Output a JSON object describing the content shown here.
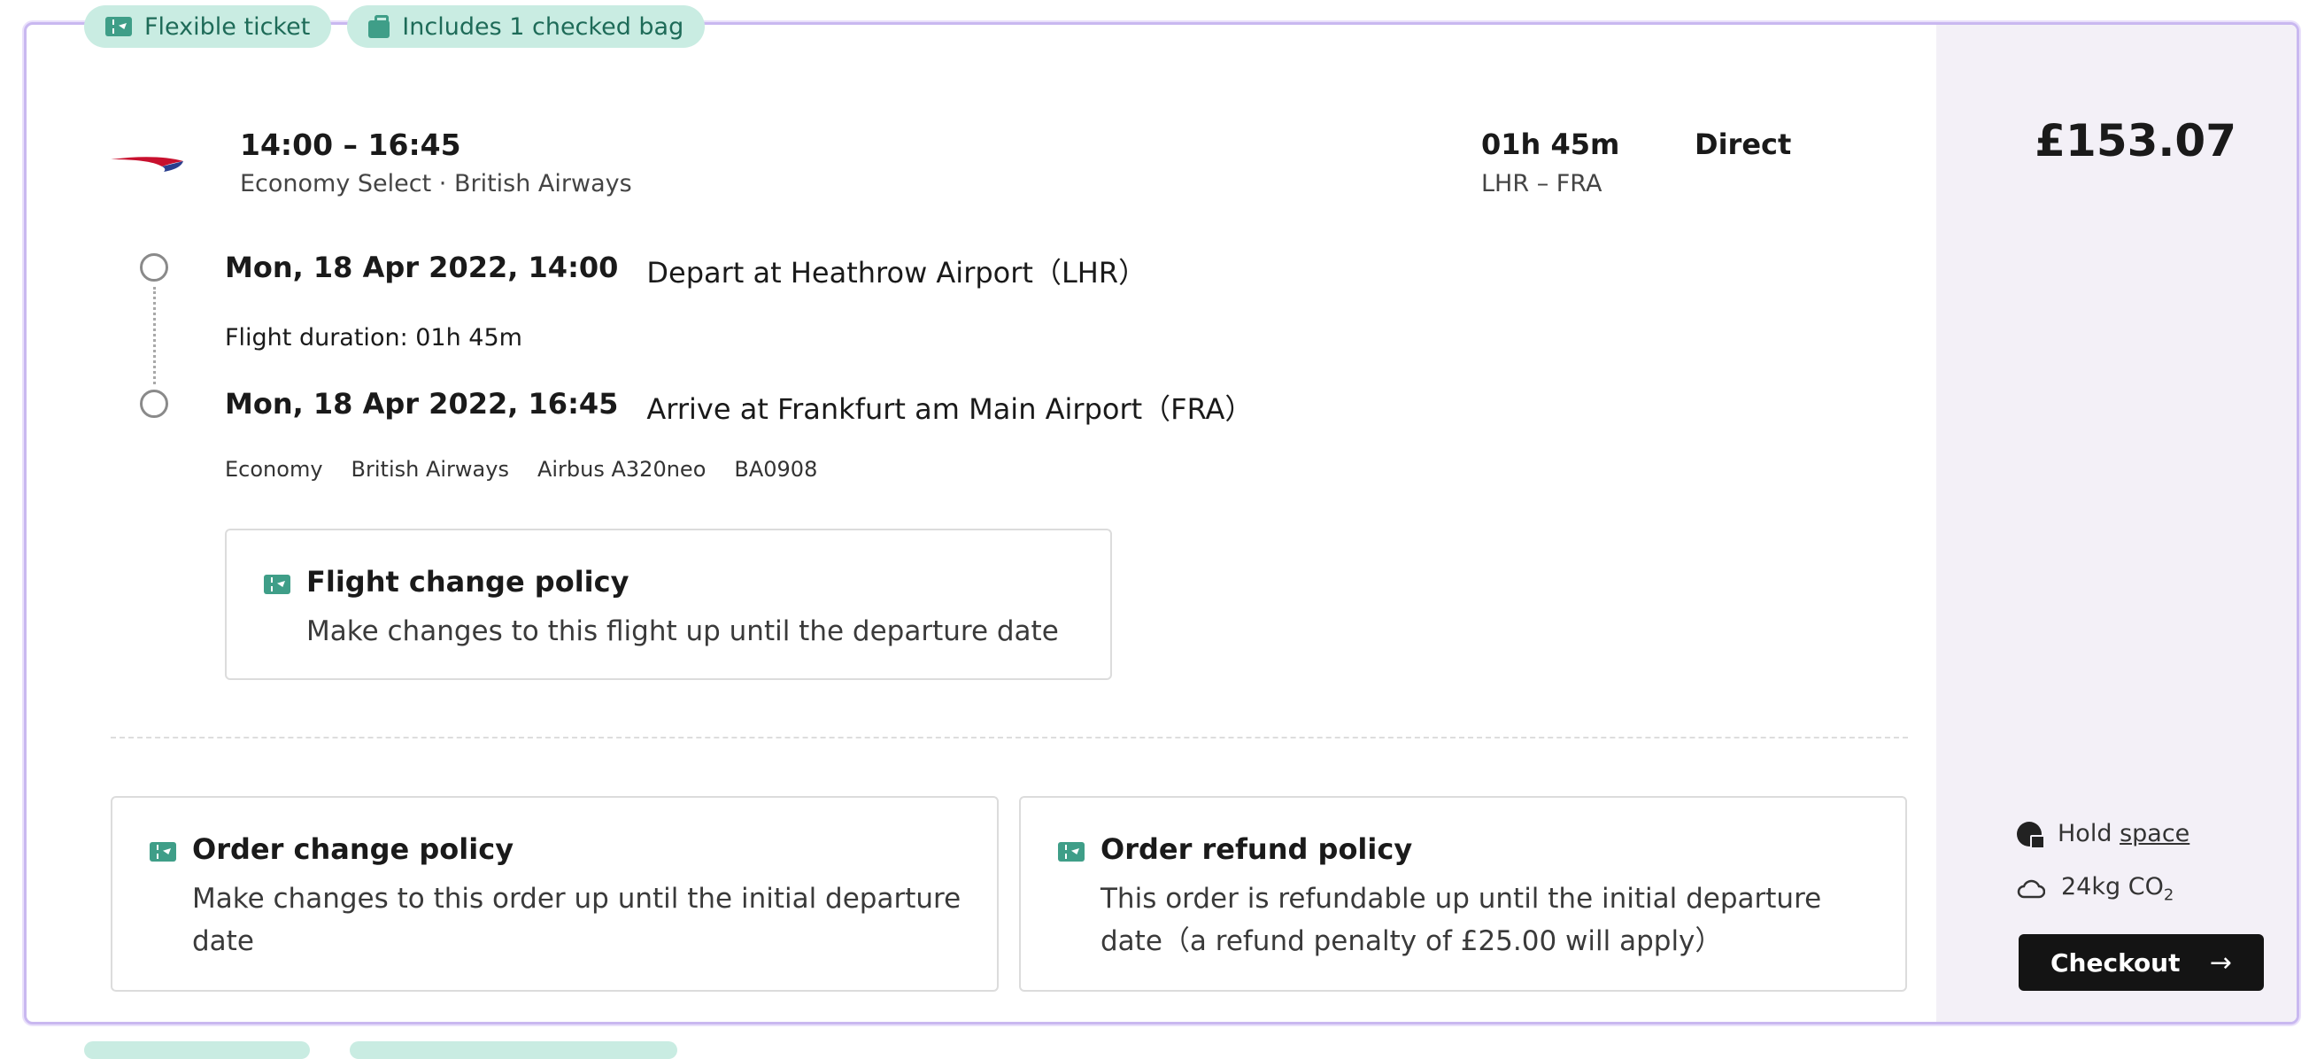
{
  "tags": [
    {
      "icon": "ticket-icon",
      "label": "Flexible ticket"
    },
    {
      "icon": "bag-icon",
      "label": "Includes 1 checked bag"
    }
  ],
  "offer": {
    "airline_logo": "british-airways-logo",
    "times": "14:00 – 16:45",
    "cabin_airline": "Economy Select · British Airways",
    "duration": "01h 45m",
    "route": "LHR – FRA",
    "stops": "Direct",
    "price": "£153.07"
  },
  "segment": {
    "depart_datetime": "Mon, 18 Apr 2022, 14:00",
    "depart_text": "Depart at Heathrow Airport（LHR）",
    "flight_duration": "Flight duration: 01h 45m",
    "arrive_datetime": "Mon, 18 Apr 2022, 16:45",
    "arrive_text": "Arrive at Frankfurt am Main Airport（FRA）",
    "meta": [
      "Economy",
      "British Airways",
      "Airbus A320neo",
      "BA0908"
    ]
  },
  "policies": {
    "flight_change": {
      "title": "Flight change policy",
      "description": "Make changes to this flight up until the departure date"
    },
    "order_change": {
      "title": "Order change policy",
      "description": "Make changes to this order up until the initial departure date"
    },
    "order_refund": {
      "title": "Order refund policy",
      "description": "This order is refundable up until the initial departure date（a refund penalty of £25.00 will apply）"
    }
  },
  "side_panel": {
    "hold_label": "Hold",
    "hold_link": "space",
    "co2_value": "24kg CO",
    "co2_sub": "2",
    "checkout_label": "Checkout",
    "checkout_arrow": "→"
  },
  "colors": {
    "tag_bg": "#c9ece2",
    "tag_text": "#1e6b58",
    "accent_green": "#3f9e88",
    "card_border": "#c9b8f0",
    "side_bg": "#f3f0f7",
    "checkout_bg": "#141414"
  }
}
